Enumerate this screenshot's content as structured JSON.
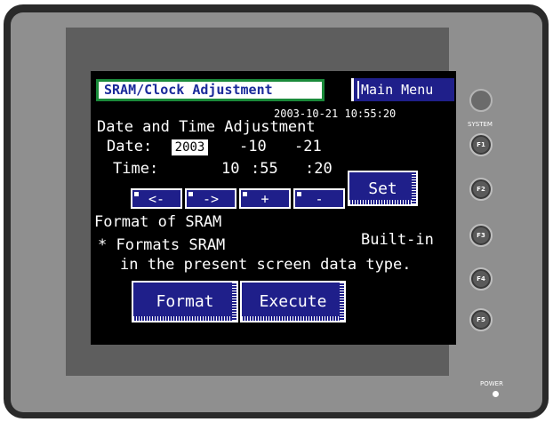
{
  "device": {
    "system_label": "SYSTEM",
    "power_label": "POWER",
    "function_keys": [
      "F1",
      "F2",
      "F3",
      "F4",
      "F5"
    ]
  },
  "screen": {
    "title": "SRAM/Clock Adjustment",
    "main_menu_label": "Main Menu",
    "datetime_display": "2003-10-21 10:55:20",
    "date_time_section": "Date and Time Adjustment",
    "date_label": "Date:",
    "year": "2003",
    "month": "-10",
    "day": "-21",
    "time_label": "Time:",
    "hour": "10",
    "minute": ":55",
    "second": ":20",
    "buttons": {
      "left": "<-",
      "right": "->",
      "plus": "+",
      "minus": "-",
      "set": "Set"
    },
    "sram_section": "Format of SRAM",
    "sram_type": "Built-in",
    "note_line1": "* Formats SRAM",
    "note_line2": "in the present screen data type.",
    "format_label": "Format",
    "execute_label": "Execute"
  },
  "colors": {
    "screen_bg": "#000000",
    "button_blue": "#1f1f8a",
    "title_border": "#1a8a3a",
    "title_text": "#1a2a9a"
  }
}
